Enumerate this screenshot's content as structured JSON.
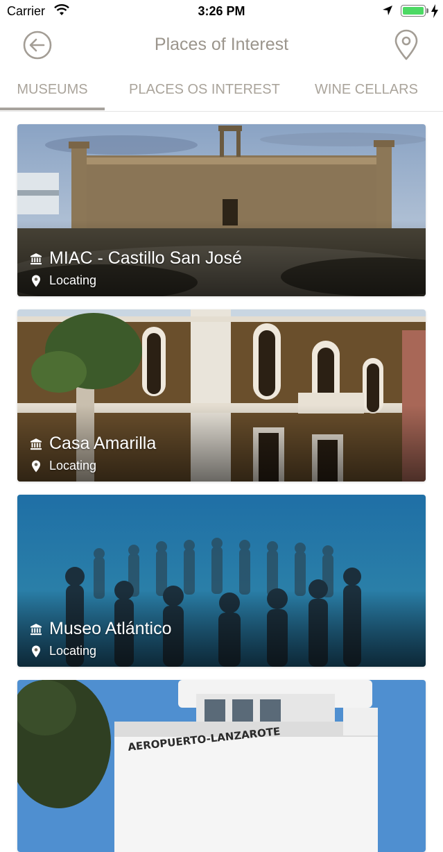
{
  "status_bar": {
    "carrier": "Carrier",
    "time": "3:26 PM"
  },
  "header": {
    "title": "Places of Interest",
    "back_icon": "arrow-left-circle-icon",
    "map_icon": "map-pin-icon"
  },
  "tabs": [
    {
      "label": "MUSEUMS",
      "active": true
    },
    {
      "label": "PLACES OS INTEREST",
      "active": false
    },
    {
      "label": "WINE CELLARS",
      "active": false
    }
  ],
  "places": [
    {
      "name": "MIAC - Castillo San José",
      "location": "Locating",
      "category_icon": "museum-icon",
      "location_icon": "location-pin-icon"
    },
    {
      "name": "Casa Amarilla",
      "location": "Locating",
      "category_icon": "museum-icon",
      "location_icon": "location-pin-icon"
    },
    {
      "name": "Museo Atlántico",
      "location": "Locating",
      "category_icon": "museum-icon",
      "location_icon": "location-pin-icon"
    },
    {
      "name": "",
      "location": "",
      "category_icon": "museum-icon",
      "location_icon": "location-pin-icon"
    }
  ],
  "photo_text": {
    "airport_sign": "AEROPUERTO-LANZAROTE"
  },
  "colors": {
    "header_gray": "#9b958c",
    "tab_gray": "#aaa49b",
    "battery_green": "#4cd964"
  }
}
